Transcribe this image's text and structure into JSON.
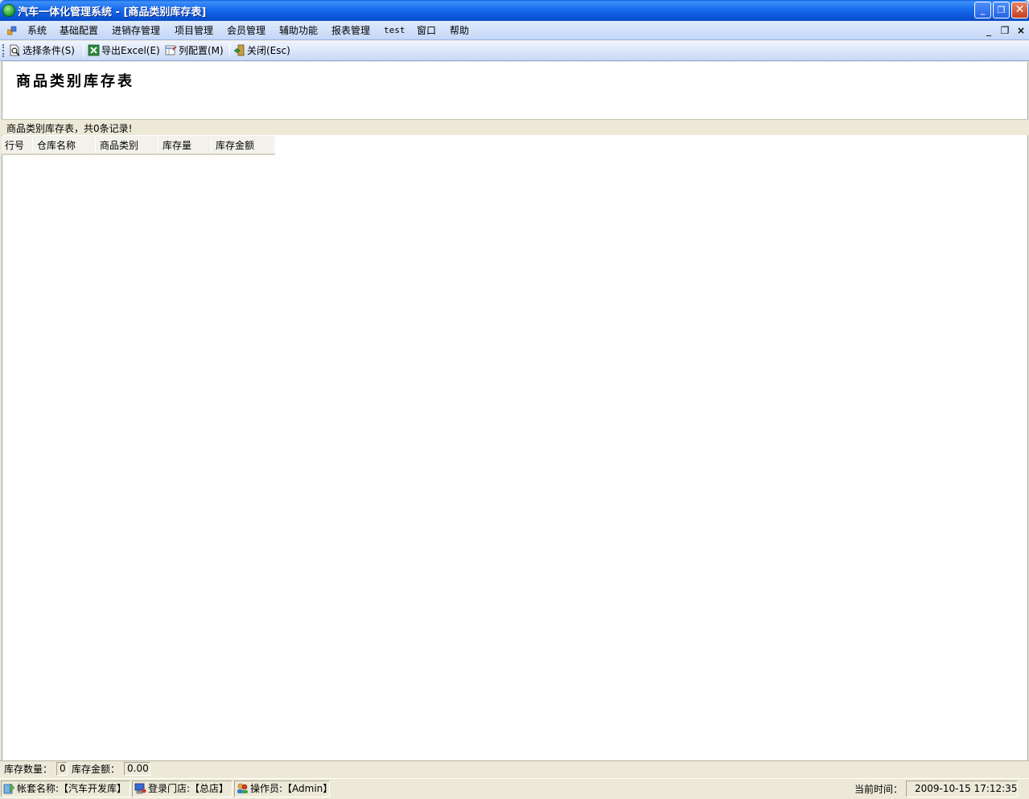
{
  "window": {
    "title": "汽车一体化管理系统 - [商品类别库存表]",
    "minimize_glyph": "_",
    "restore_glyph": "❐",
    "close_glyph": "✕"
  },
  "menu": {
    "items": [
      "系统",
      "基础配置",
      "进销存管理",
      "项目管理",
      "会员管理",
      "辅助功能",
      "报表管理",
      "test",
      "窗口",
      "帮助"
    ],
    "mdi_minimize": "_",
    "mdi_restore": "❐",
    "mdi_close": "×"
  },
  "toolbar": {
    "select_conditions": "选择条件(S)",
    "export_excel": "导出Excel(E)",
    "column_config": "列配置(M)",
    "close": "关闭(Esc)"
  },
  "report": {
    "title": "商品类别库存表",
    "record_summary": "商品类别库存表，共0条记录!",
    "columns": [
      "行号",
      "仓库名称",
      "商品类别",
      "库存量",
      "库存金额"
    ]
  },
  "summary": {
    "qty_label": "库存数量：",
    "qty_value": "0",
    "amount_label": "库存金额：",
    "amount_value": "0.00"
  },
  "status": {
    "account": "帐套名称:【汽车开发库】",
    "store": "登录门店:【总店】",
    "operator": "操作员:【Admin】",
    "time_label": "当前时间：",
    "time_value": "2009-10-15 17:12:35"
  },
  "colors": {
    "title_bar": "#1c6ef0",
    "menu_bar": "#c4d7f7",
    "chrome": "#ece9d8"
  }
}
